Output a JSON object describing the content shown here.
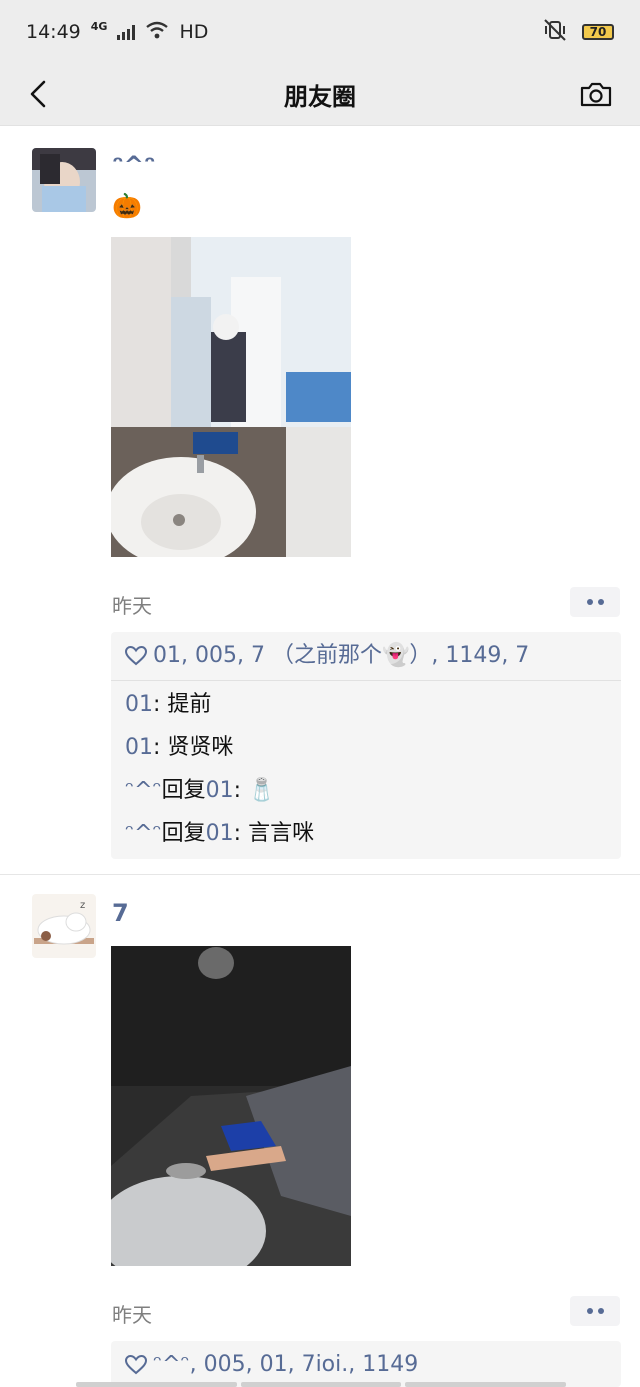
{
  "status": {
    "time": "14:49",
    "network": "4G",
    "hd": "HD",
    "battery": "70",
    "icons": [
      "signal-icon",
      "wifi-icon",
      "mute-vibrate-icon",
      "battery-icon"
    ]
  },
  "nav": {
    "title": "朋友圈",
    "back_icon": "chevron-left-icon",
    "camera_icon": "camera-icon"
  },
  "posts": [
    {
      "nickname": "ᵔ^ᵔ",
      "text": "🎃",
      "time": "昨天",
      "likes": "01, 005, 7 （之前那个👻）, 1149, 7",
      "comments": [
        {
          "author": "01",
          "sep": ": ",
          "text": "提前"
        },
        {
          "author": "01",
          "sep": ": ",
          "text": "贤贤咪"
        },
        {
          "author": "ᵔ^ᵔ",
          "mid": "回复",
          "reply_to": "01",
          "sep": ": ",
          "text": "🧂"
        },
        {
          "author": "ᵔ^ᵔ",
          "mid": "回复",
          "reply_to": "01",
          "sep": ": ",
          "text": "言言咪"
        }
      ]
    },
    {
      "nickname": "7",
      "time": "昨天",
      "likes": "ᵔ^ᵔ, 005, 01, 7ioi., 1149"
    }
  ]
}
